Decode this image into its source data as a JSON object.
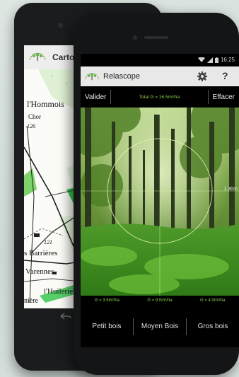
{
  "back_phone": {
    "app_title": "Carto",
    "map_labels": {
      "hommois": "l'Hommois",
      "chor": "Chor",
      "num126": "126",
      "num121": "121",
      "barrieres": "s Barrières",
      "varennes": "Varennes",
      "huilerie": "l'Huilerie",
      "iere": "nière"
    }
  },
  "front_phone": {
    "status": {
      "time": "16:25"
    },
    "app": {
      "title": "Relascope"
    },
    "toolbar": {
      "validate_label": "Valider",
      "total_label": "Total G = 16.5m²/ha",
      "clear_label": "Effacer"
    },
    "view": {
      "distance_label": "1.30m"
    },
    "values": {
      "petit": "G = 3.5m²/ha",
      "moyen": "G = 9.0m²/ha",
      "gros": "G = 4.0m²/ha"
    },
    "buttons": {
      "petit_bois": "Petit bois",
      "moyen_bois": "Moyen Bois",
      "gros_bois": "Gros bois"
    }
  },
  "colors": {
    "accent_green": "#8fd14f",
    "appbar": "#e8e8e8"
  }
}
